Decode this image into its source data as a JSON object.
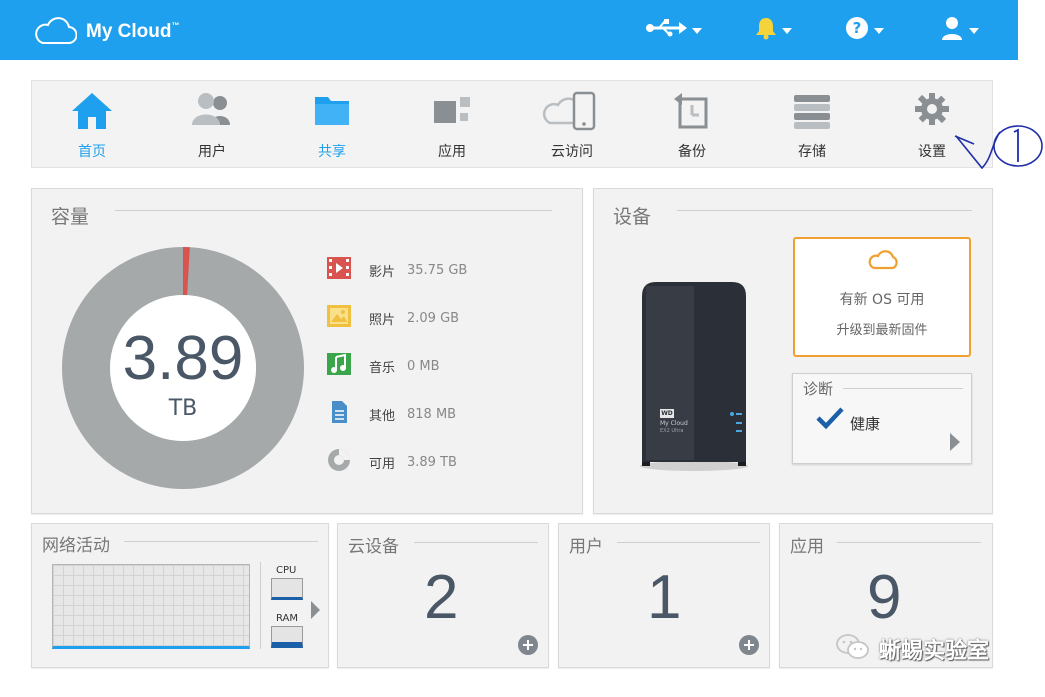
{
  "header": {
    "brand": "My Cloud",
    "trademark": "™",
    "icons": [
      "usb-icon",
      "bell-icon",
      "help-icon",
      "user-icon"
    ],
    "accent_color": "#1fa0ef",
    "bell_color": "#f5d33a"
  },
  "nav": {
    "items": [
      {
        "label": "首页",
        "icon": "home-icon",
        "active": true
      },
      {
        "label": "用户",
        "icon": "users-icon"
      },
      {
        "label": "共享",
        "icon": "folder-icon",
        "active": true
      },
      {
        "label": "应用",
        "icon": "apps-icon"
      },
      {
        "label": "云访问",
        "icon": "cloud-access-icon"
      },
      {
        "label": "备份",
        "icon": "backup-icon"
      },
      {
        "label": "存储",
        "icon": "storage-icon"
      },
      {
        "label": "设置",
        "icon": "gear-icon"
      }
    ]
  },
  "capacity": {
    "title": "容量",
    "total_value": "3.89",
    "total_unit": "TB",
    "used_fraction": 0.009,
    "legend": [
      {
        "name": "影片",
        "value": "35.75 GB",
        "icon": "video-icon",
        "color": "#d9534f"
      },
      {
        "name": "照片",
        "value": "2.09 GB",
        "icon": "photo-icon",
        "color": "#f0c040"
      },
      {
        "name": "音乐",
        "value": "0 MB",
        "icon": "music-icon",
        "color": "#3aa54a"
      },
      {
        "name": "其他",
        "value": "818 MB",
        "icon": "document-icon",
        "color": "#4a8ec9"
      },
      {
        "name": "可用",
        "value": "3.89 TB",
        "icon": "pie-icon",
        "color": "#a5a9aa"
      }
    ]
  },
  "device": {
    "title": "设备",
    "device_badge_text": "WD",
    "device_label": "My Cloud",
    "device_model": "EX2 Ultra",
    "update_title": "有新 OS 可用",
    "update_sub": "升级到最新固件",
    "update_color": "#f0a030",
    "diag_title": "诊断",
    "diag_status": "健康"
  },
  "network": {
    "title": "网络活动",
    "cpu_label": "CPU",
    "ram_label": "RAM"
  },
  "tiles": {
    "cloud_devices": {
      "title": "云设备",
      "count": "2"
    },
    "users": {
      "title": "用户",
      "count": "1"
    },
    "apps": {
      "title": "应用",
      "count": "9"
    }
  },
  "watermark": "蜥蜴实验室"
}
